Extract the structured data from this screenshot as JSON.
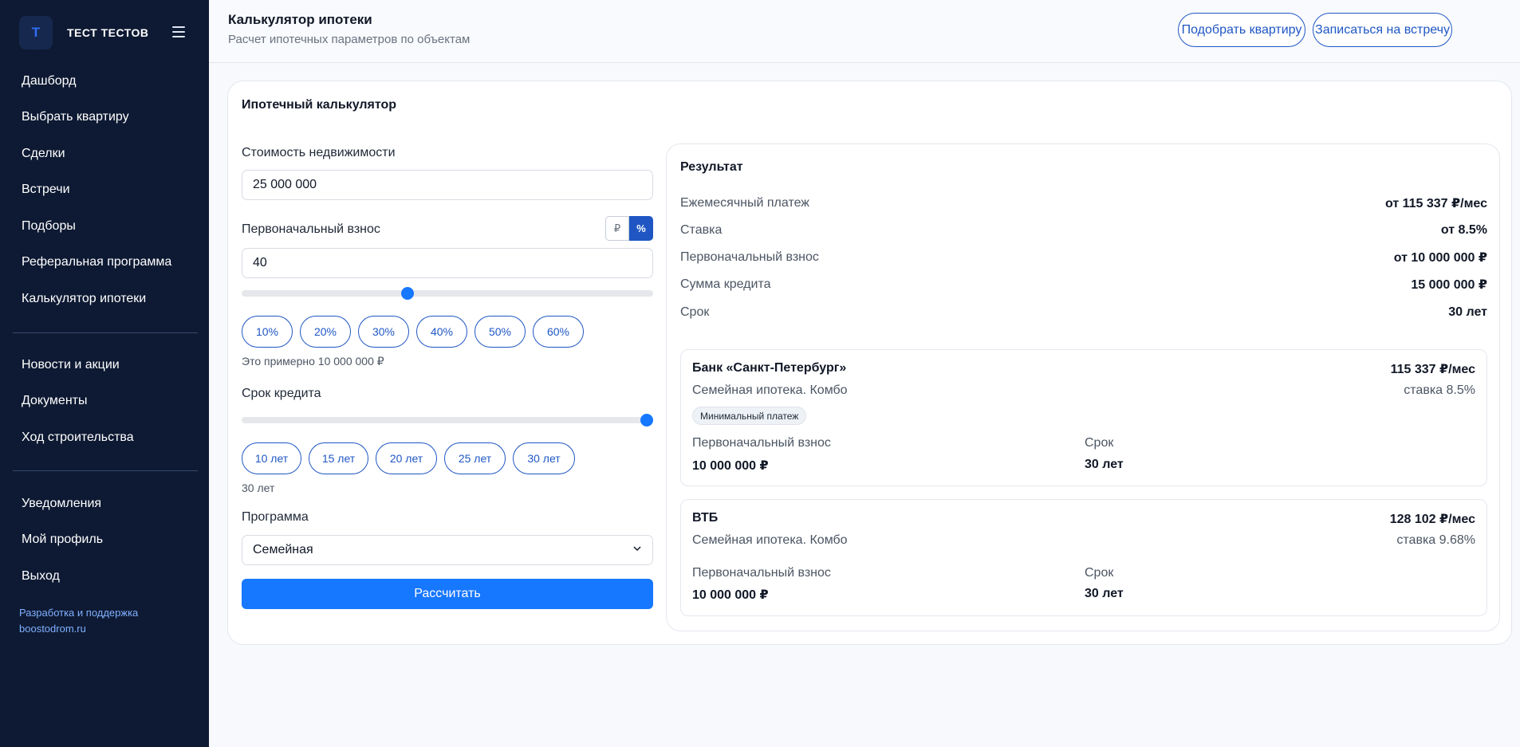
{
  "sidebar": {
    "avatar_letter": "Т",
    "user_name": "ТЕСТ ТЕСТОВ",
    "nav_main": [
      {
        "label": "Дашборд"
      },
      {
        "label": "Выбрать квартиру"
      },
      {
        "label": "Сделки"
      },
      {
        "label": "Встречи"
      },
      {
        "label": "Подборы"
      },
      {
        "label": "Реферальная программа"
      },
      {
        "label": "Калькулятор ипотеки"
      }
    ],
    "nav_info": [
      {
        "label": "Новости и акции"
      },
      {
        "label": "Документы"
      },
      {
        "label": "Ход строительства"
      }
    ],
    "nav_account": [
      {
        "label": "Уведомления"
      },
      {
        "label": "Мой профиль"
      },
      {
        "label": "Выход"
      }
    ],
    "footer_line1": "Разработка и поддержка",
    "footer_line2": "boostodrom.ru"
  },
  "header": {
    "title": "Калькулятор ипотеки",
    "subtitle": "Расчет ипотечных параметров по объектам",
    "btn_pick": "Подобрать квартиру",
    "btn_meet": "Записаться на встречу"
  },
  "calculator": {
    "title": "Ипотечный калькулятор",
    "price_label": "Стоимость недвижимости",
    "price_value": "25 000 000",
    "down_label": "Первоначальный взнос",
    "unit_rub": "₽",
    "unit_pct": "%",
    "unit_selected": "%",
    "down_value": "40",
    "down_slider_fraction": 0.4,
    "down_chips": [
      "10%",
      "20%",
      "30%",
      "40%",
      "50%",
      "60%"
    ],
    "down_hint": "Это примерно 10 000 000 ₽",
    "term_label": "Срок кредита",
    "term_slider_fraction": 1.0,
    "term_chips": [
      "10 лет",
      "15 лет",
      "20 лет",
      "25 лет",
      "30 лет"
    ],
    "term_hint": "30 лет",
    "program_label": "Программа",
    "program_value": "Семейная",
    "calc_button": "Рассчитать"
  },
  "result": {
    "title": "Результат",
    "rows": [
      {
        "k": "Ежемесячный платеж",
        "v": "от 115 337 ₽/мес"
      },
      {
        "k": "Ставка",
        "v": "от 8.5%"
      },
      {
        "k": "Первоначальный взнос",
        "v": "от 10 000 000 ₽"
      },
      {
        "k": "Сумма кредита",
        "v": "15 000 000 ₽"
      },
      {
        "k": "Срок",
        "v": "30 лет"
      }
    ],
    "banks": [
      {
        "name": "Банк «Санкт-Петербург»",
        "payment": "115 337 ₽/мес",
        "program": "Семейная ипотека. Комбо",
        "rate": "ставка 8.5%",
        "badge": "Минимальный платеж",
        "down_label": "Первоначальный взнос",
        "down_value": "10 000 000 ₽",
        "term_label": "Срок",
        "term_value": "30 лет"
      },
      {
        "name": "ВТБ",
        "payment": "128 102 ₽/мес",
        "program": "Семейная ипотека. Комбо",
        "rate": "ставка 9.68%",
        "down_label": "Первоначальный взнос",
        "down_value": "10 000 000 ₽",
        "term_label": "Срок",
        "term_value": "30 лет"
      }
    ]
  },
  "colors": {
    "sidebar_bg": "#0e1a33",
    "accent": "#1f56c4",
    "primary_button": "#1677ff"
  }
}
